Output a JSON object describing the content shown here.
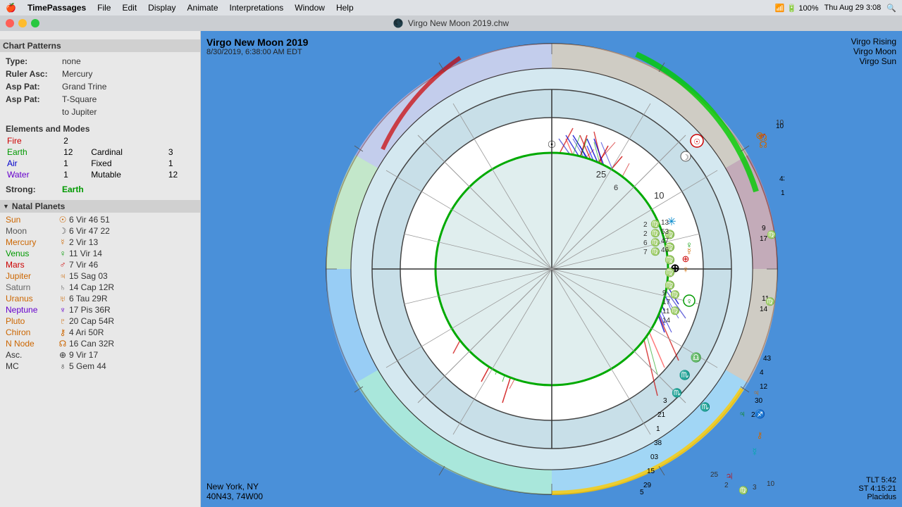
{
  "menubar": {
    "apple": "🍎",
    "app_name": "TimePassages",
    "menus": [
      "File",
      "Edit",
      "Display",
      "Animate",
      "Interpretations",
      "Window",
      "Help"
    ],
    "right": {
      "battery": "100%",
      "time": "Thu Aug 29  3:08"
    }
  },
  "titlebar": {
    "title": "Virgo New Moon 2019.chw"
  },
  "sidebar": {
    "section_title": "Chart Patterns",
    "type_label": "Type:",
    "type_value": "none",
    "ruler_label": "Ruler Asc:",
    "ruler_value": "Mercury",
    "asp_pat_label1": "Asp Pat:",
    "asp_pat_value1": "Grand Trine",
    "asp_pat_label2": "Asp Pat:",
    "asp_pat_value2": "T-Square",
    "asp_pat_value2b": "to Jupiter",
    "elements_title": "Elements and Modes",
    "elements": [
      {
        "name": "Fire",
        "color": "fire",
        "count": "2",
        "mode": "",
        "mode_count": ""
      },
      {
        "name": "Earth",
        "color": "earth",
        "count": "12",
        "mode": "Cardinal",
        "mode_count": "3"
      },
      {
        "name": "Air",
        "color": "air",
        "count": "1",
        "mode": "Fixed",
        "mode_count": "1"
      },
      {
        "name": "Water",
        "color": "water",
        "count": "1",
        "mode": "Mutable",
        "mode_count": "12"
      }
    ],
    "strong_label": "Strong:",
    "strong_value": "Earth",
    "natal_planets_title": "Natal Planets",
    "planets": [
      {
        "name": "Sun",
        "color": "sun",
        "symbol": "☉",
        "data": "6 Vir 46 51"
      },
      {
        "name": "Moon",
        "color": "moon",
        "symbol": "☽",
        "data": "6 Vir 47 22"
      },
      {
        "name": "Mercury",
        "color": "mercury",
        "symbol": "☿",
        "data": "2 Vir 13"
      },
      {
        "name": "Venus",
        "color": "venus",
        "symbol": "♀",
        "data": "11 Vir 14"
      },
      {
        "name": "Mars",
        "color": "mars",
        "symbol": "♂",
        "data": "7 Vir 46"
      },
      {
        "name": "Jupiter",
        "color": "jupiter",
        "symbol": "♃",
        "data": "15 Sag 03"
      },
      {
        "name": "Saturn",
        "color": "saturn",
        "symbol": "♄",
        "data": "14 Cap 12R"
      },
      {
        "name": "Uranus",
        "color": "uranus",
        "symbol": "♅",
        "data": "6 Tau 29R"
      },
      {
        "name": "Neptune",
        "color": "neptune",
        "symbol": "♆",
        "data": "17 Pis 36R"
      },
      {
        "name": "Pluto",
        "color": "pluto",
        "symbol": "♇",
        "data": "20 Cap 54R"
      },
      {
        "name": "Chiron",
        "color": "chiron",
        "symbol": "⚷",
        "data": "4 Ari 50R"
      },
      {
        "name": "N Node",
        "color": "node",
        "symbol": "☊",
        "data": "16 Can 32R"
      },
      {
        "name": "Asc.",
        "color": "asc",
        "symbol": "⊕",
        "data": "9 Vir 17"
      },
      {
        "name": "MC",
        "color": "mc",
        "symbol": "♁",
        "data": "5 Gem 44"
      }
    ]
  },
  "chart": {
    "title": "Virgo New Moon 2019",
    "date": "8/30/2019, 6:38:00 AM EDT",
    "top_right": {
      "line1": "Virgo Rising",
      "line2": "Virgo Moon",
      "line3": "Virgo Sun"
    },
    "bottom_left": {
      "line1": "New York, NY",
      "line2": "40N43, 74W00"
    },
    "bottom_right": {
      "line1": "TLT 5:42",
      "line2": "ST 4:15:21",
      "line3": "Placidus"
    }
  }
}
